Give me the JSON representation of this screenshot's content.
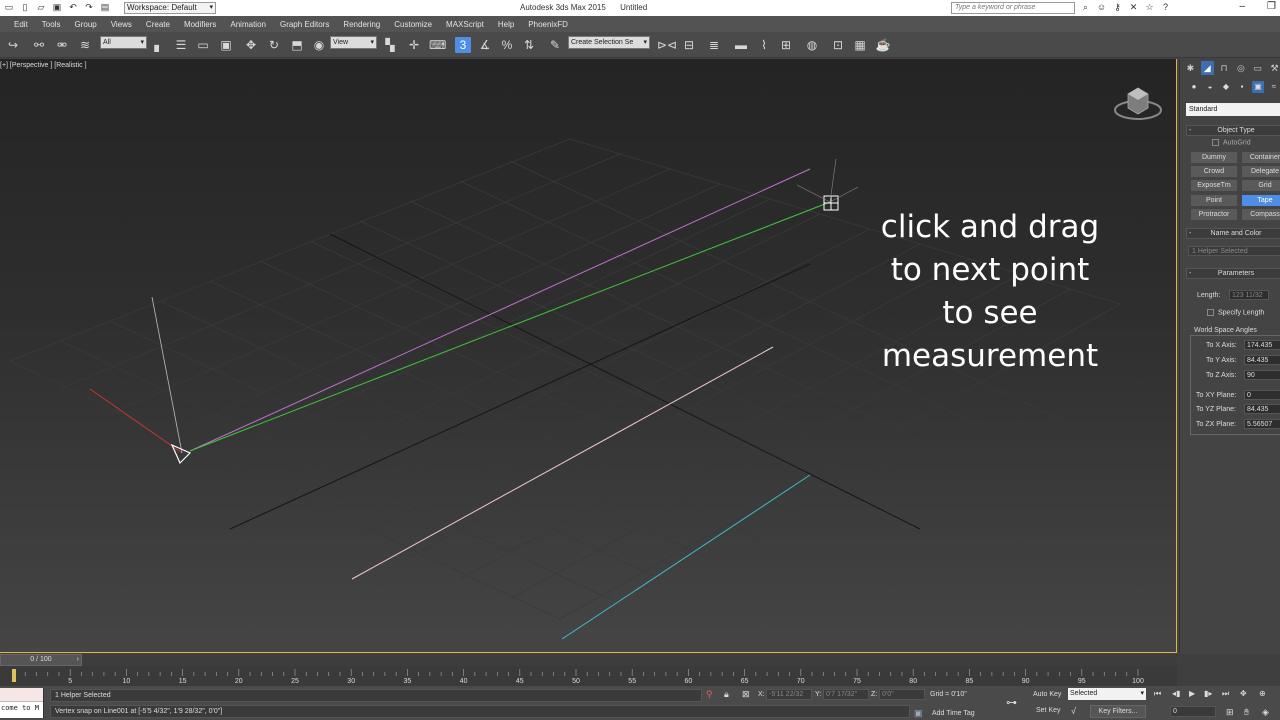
{
  "titlebar": {
    "workspace": "Workspace: Default",
    "app": "Autodesk 3ds Max  2015",
    "doc": "Untitled",
    "search_placeholder": "Type a keyword or phrase"
  },
  "menu": [
    "Edit",
    "Tools",
    "Group",
    "Views",
    "Create",
    "Modifiers",
    "Animation",
    "Graph Editors",
    "Rendering",
    "Customize",
    "MAXScript",
    "Help",
    "PhoenixFD"
  ],
  "toolbar": {
    "filter": "All",
    "ref_coord": "View",
    "named_selection": "Create Selection Se"
  },
  "viewport": {
    "label": "[+] [Perspective ] [Realistic ]",
    "instruction": [
      "click and drag",
      "to next point",
      "to see",
      "measurement"
    ]
  },
  "command_panel": {
    "category": "Standard",
    "object_type_title": "Object Type",
    "autogrid": "AutoGrid",
    "buttons": [
      "Dummy",
      "Container",
      "Crowd",
      "Delegate",
      "ExposeTm",
      "Grid",
      "Point",
      "Tape",
      "Protractor",
      "Compass"
    ],
    "name_color_title": "Name and Color",
    "name_field": "1 Helper Selected",
    "parameters_title": "Parameters",
    "length_label": "Length:",
    "length_value": "123 11/32",
    "specify_length": "Specify Length",
    "world_space_angles": "World Space Angles",
    "angles": [
      {
        "label": "To X Axis:",
        "value": "174.435"
      },
      {
        "label": "To Y Axis:",
        "value": "84.435"
      },
      {
        "label": "To Z Axis:",
        "value": "90"
      },
      {
        "label": "To XY Plane:",
        "value": "0"
      },
      {
        "label": "To YZ Plane:",
        "value": "84.435"
      },
      {
        "label": "To ZX Plane:",
        "value": "5.56507"
      }
    ]
  },
  "timeline": {
    "slider": "0 / 100",
    "ticks": [
      "0",
      "5",
      "10",
      "15",
      "20",
      "25",
      "30",
      "35",
      "40",
      "45",
      "50",
      "55",
      "60",
      "65",
      "70",
      "75",
      "80",
      "85",
      "90",
      "95",
      "100"
    ]
  },
  "status": {
    "maxscript_text": "come to M",
    "selection": "1 Helper Selected",
    "prompt": "Vertex snap on Line001 at [-5'5 4/32\", 1'9 28/32\", 0'0\"]",
    "x_label": "X:",
    "x_value": "-5'11 22/32",
    "y_label": "Y:",
    "y_value": "0'7 17/32\"",
    "z_label": "Z:",
    "z_value": "0'0\"",
    "grid": "Grid = 0'10\"",
    "add_time_tag": "Add Time Tag",
    "auto_key": "Auto Key",
    "set_key": "Set Key",
    "key_mode": "Selected",
    "key_filters": "Key Filters...",
    "frame": "0"
  }
}
